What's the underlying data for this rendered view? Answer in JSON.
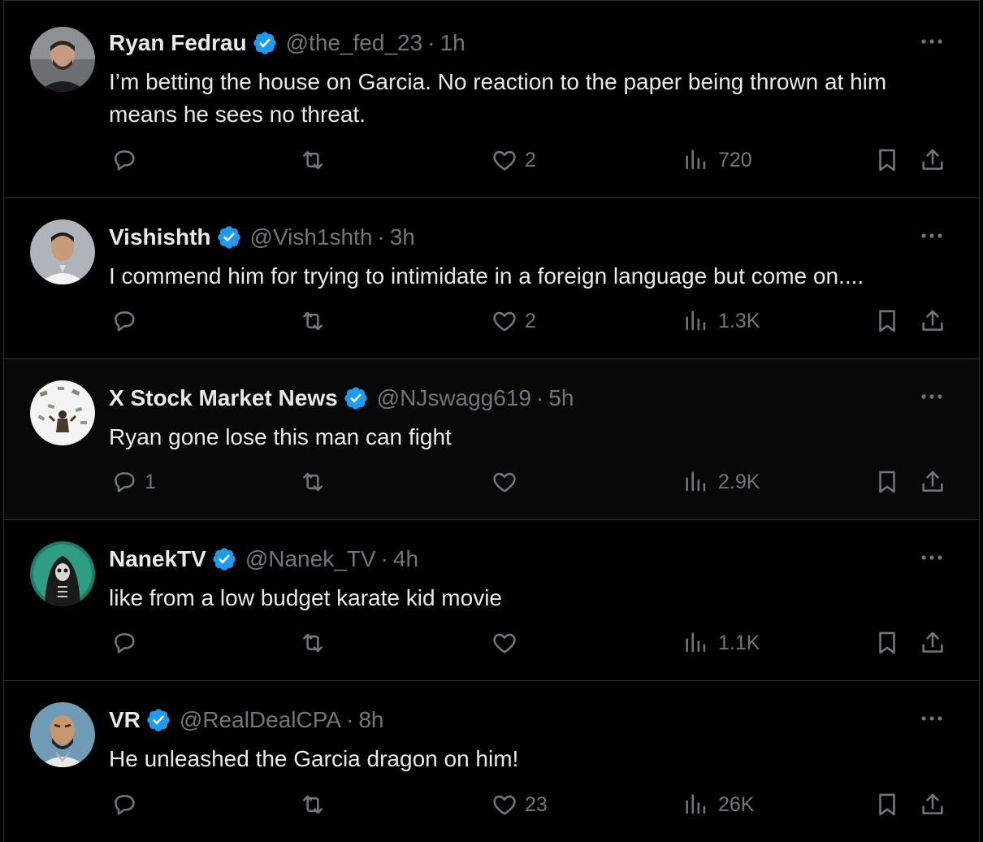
{
  "colors": {
    "background": "#000000",
    "text": "#e7e9ea",
    "muted": "#71767b",
    "divider": "#2f3336",
    "verified": "#1d9bf0"
  },
  "icons": {
    "verified": "verified-badge-icon",
    "more": "more-options-icon",
    "reply": "reply-icon",
    "retweet": "retweet-icon",
    "like": "heart-icon",
    "views": "views-icon",
    "bookmark": "bookmark-icon",
    "share": "share-icon"
  },
  "tweets": [
    {
      "name": "Ryan Fedrau",
      "handle": "@the_fed_23",
      "separator": "·",
      "time": "1h",
      "text": "I’m betting the house on Garcia. No reaction to the paper being thrown at him means he sees no threat.",
      "replies": "",
      "retweets": "",
      "likes": "2",
      "views": "720"
    },
    {
      "name": "Vishishth",
      "handle": "@Vish1shth",
      "separator": "·",
      "time": "3h",
      "text": "I commend him for trying to intimidate in a foreign language but come on....",
      "replies": "",
      "retweets": "",
      "likes": "2",
      "views": "1.3K"
    },
    {
      "name": "X Stock Market News",
      "handle": "@NJswagg619",
      "separator": "·",
      "time": "5h",
      "text": "Ryan gone lose this man can fight",
      "replies": "1",
      "retweets": "",
      "likes": "",
      "views": "2.9K"
    },
    {
      "name": "NanekTV",
      "handle": "@Nanek_TV",
      "separator": "·",
      "time": "4h",
      "text": "like from a low budget karate kid movie",
      "replies": "",
      "retweets": "",
      "likes": "",
      "views": "1.1K"
    },
    {
      "name": "VR",
      "handle": "@RealDealCPA",
      "separator": "·",
      "time": "8h",
      "text": "He unleashed the Garcia dragon on him!",
      "replies": "",
      "retweets": "",
      "likes": "23",
      "views": "26K"
    }
  ]
}
